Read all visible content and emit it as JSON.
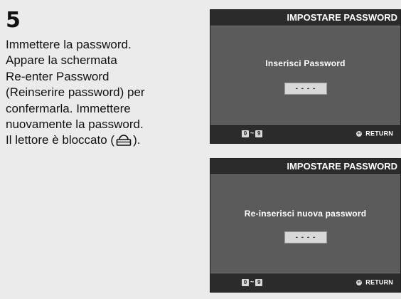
{
  "step": {
    "number": "5"
  },
  "instructions": {
    "lines": [
      "Immettere la password.",
      "Appare la schermata",
      "Re-enter Password",
      "(Reinserire password) per",
      "confermarla. Immettere",
      "nuovamente la password."
    ],
    "last_line_before_icon": "Il lettore è bloccato (",
    "last_line_after_icon": ").",
    "inline_icon": "lock-icon"
  },
  "screens": [
    {
      "header_title": "IMPOSTARE PASSWORD",
      "prompt": "Inserisci Password",
      "password_mask": "- - - -",
      "footer": {
        "digit_from": "0",
        "range_separator": "~",
        "digit_to": "9",
        "return_label": "RETURN"
      }
    },
    {
      "header_title": "IMPOSTARE PASSWORD",
      "prompt": "Re-inserisci nuova password",
      "password_mask": "- - - -",
      "footer": {
        "digit_from": "0",
        "range_separator": "~",
        "digit_to": "9",
        "return_label": "RETURN"
      }
    }
  ]
}
